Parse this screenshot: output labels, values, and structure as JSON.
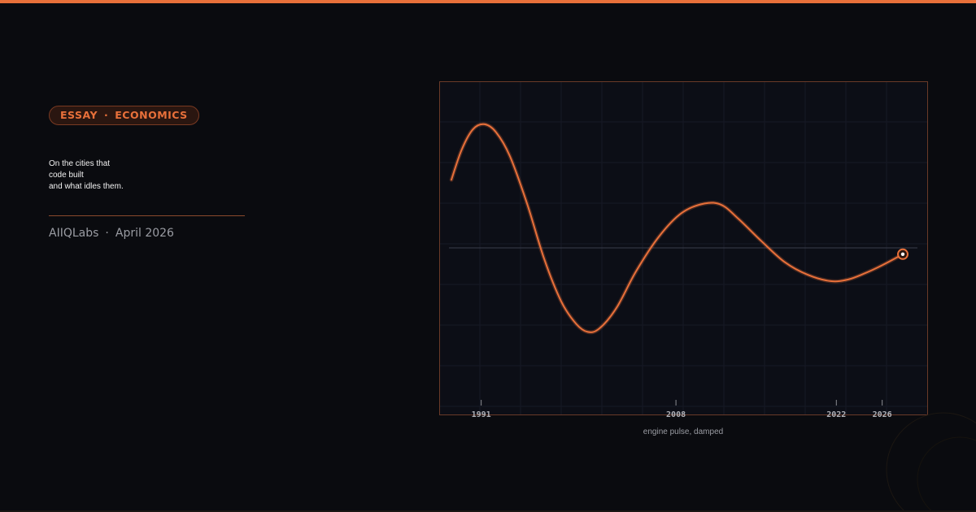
{
  "tag": {
    "left": "ESSAY",
    "separator": "·",
    "right": "ECONOMICS"
  },
  "title_lines": [
    "On the cities that",
    "code built",
    "and what idles them."
  ],
  "byline": {
    "author": "AIIQLabs",
    "separator": "·",
    "date": "April 2026"
  },
  "colors": {
    "accent": "#e8703a",
    "background": "#0a0b0f",
    "plot_bg": "#0c0e16",
    "grid": "#1a1d2a",
    "frame": "#6a3a28"
  },
  "chart_data": {
    "type": "line",
    "title": "",
    "xlabel": "engine pulse, damped",
    "ylabel": "",
    "xlim": [
      1988.4,
      2027.8
    ],
    "ylim": [
      -1,
      1
    ],
    "x_ticks": [
      1991,
      2008,
      2022,
      2026
    ],
    "grid": true,
    "legend": "none",
    "baseline": 0,
    "series": [
      {
        "values": [
          {
            "x": 1988.4,
            "y": 0.43
          },
          {
            "x": 1989.3,
            "y": 0.62
          },
          {
            "x": 1990.3,
            "y": 0.75
          },
          {
            "x": 1991.3,
            "y": 0.78
          },
          {
            "x": 1992.3,
            "y": 0.73
          },
          {
            "x": 1993.5,
            "y": 0.58
          },
          {
            "x": 1995.0,
            "y": 0.28
          },
          {
            "x": 1996.5,
            "y": -0.07
          },
          {
            "x": 1998.0,
            "y": -0.34
          },
          {
            "x": 1999.3,
            "y": -0.48
          },
          {
            "x": 2000.3,
            "y": -0.53
          },
          {
            "x": 2001.3,
            "y": -0.51
          },
          {
            "x": 2002.8,
            "y": -0.38
          },
          {
            "x": 2004.5,
            "y": -0.15
          },
          {
            "x": 2006.5,
            "y": 0.07
          },
          {
            "x": 2008.5,
            "y": 0.22
          },
          {
            "x": 2010.5,
            "y": 0.28
          },
          {
            "x": 2012.0,
            "y": 0.27
          },
          {
            "x": 2013.5,
            "y": 0.18
          },
          {
            "x": 2015.5,
            "y": 0.04
          },
          {
            "x": 2017.5,
            "y": -0.09
          },
          {
            "x": 2019.5,
            "y": -0.17
          },
          {
            "x": 2021.5,
            "y": -0.21
          },
          {
            "x": 2023.0,
            "y": -0.2
          },
          {
            "x": 2024.5,
            "y": -0.16
          },
          {
            "x": 2026.0,
            "y": -0.11
          },
          {
            "x": 2027.8,
            "y": -0.04
          }
        ]
      }
    ],
    "end_marker": {
      "x": 2027.8,
      "y": -0.04
    }
  }
}
